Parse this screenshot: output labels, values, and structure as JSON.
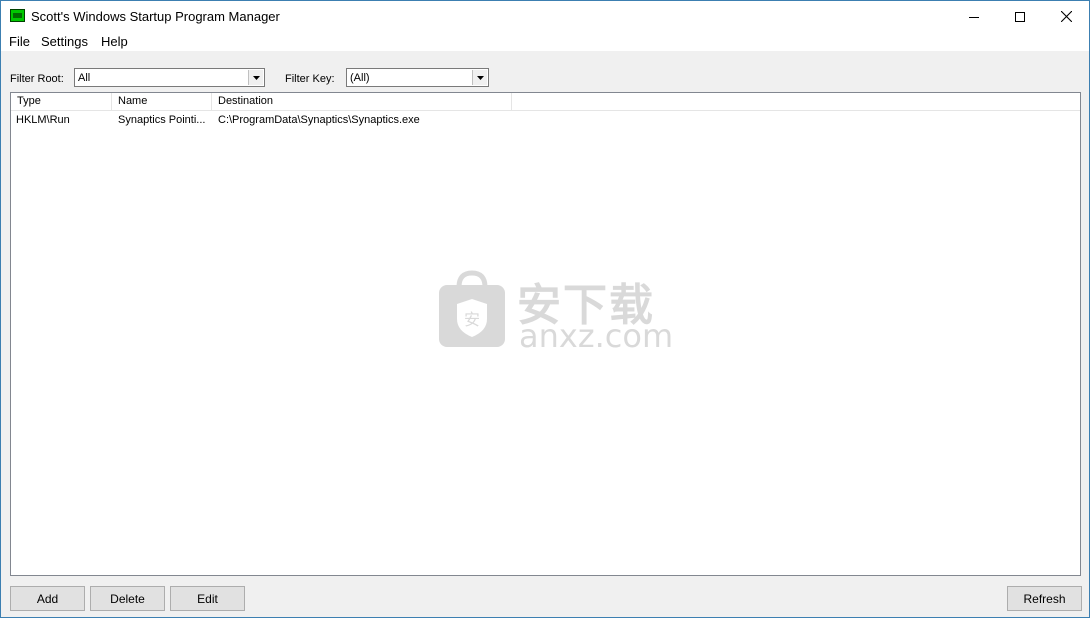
{
  "window": {
    "title": "Scott's Windows Startup Program Manager",
    "icon": "app-green-icon"
  },
  "menu": [
    "File",
    "Settings",
    "Help"
  ],
  "filters": {
    "root_label": "Filter Root:",
    "root_value": "All",
    "key_label": "Filter Key:",
    "key_value": "(All)"
  },
  "table": {
    "columns": [
      "Type",
      "Name",
      "Destination"
    ],
    "rows": [
      [
        "HKLM\\Run",
        "Synaptics Pointi...",
        "C:\\ProgramData\\Synaptics\\Synaptics.exe"
      ]
    ]
  },
  "watermark": {
    "cn": "安下载",
    "en": "anxz.com",
    "badge": "安"
  },
  "buttons": {
    "add": "Add",
    "delete": "Delete",
    "edit": "Edit",
    "refresh": "Refresh"
  }
}
